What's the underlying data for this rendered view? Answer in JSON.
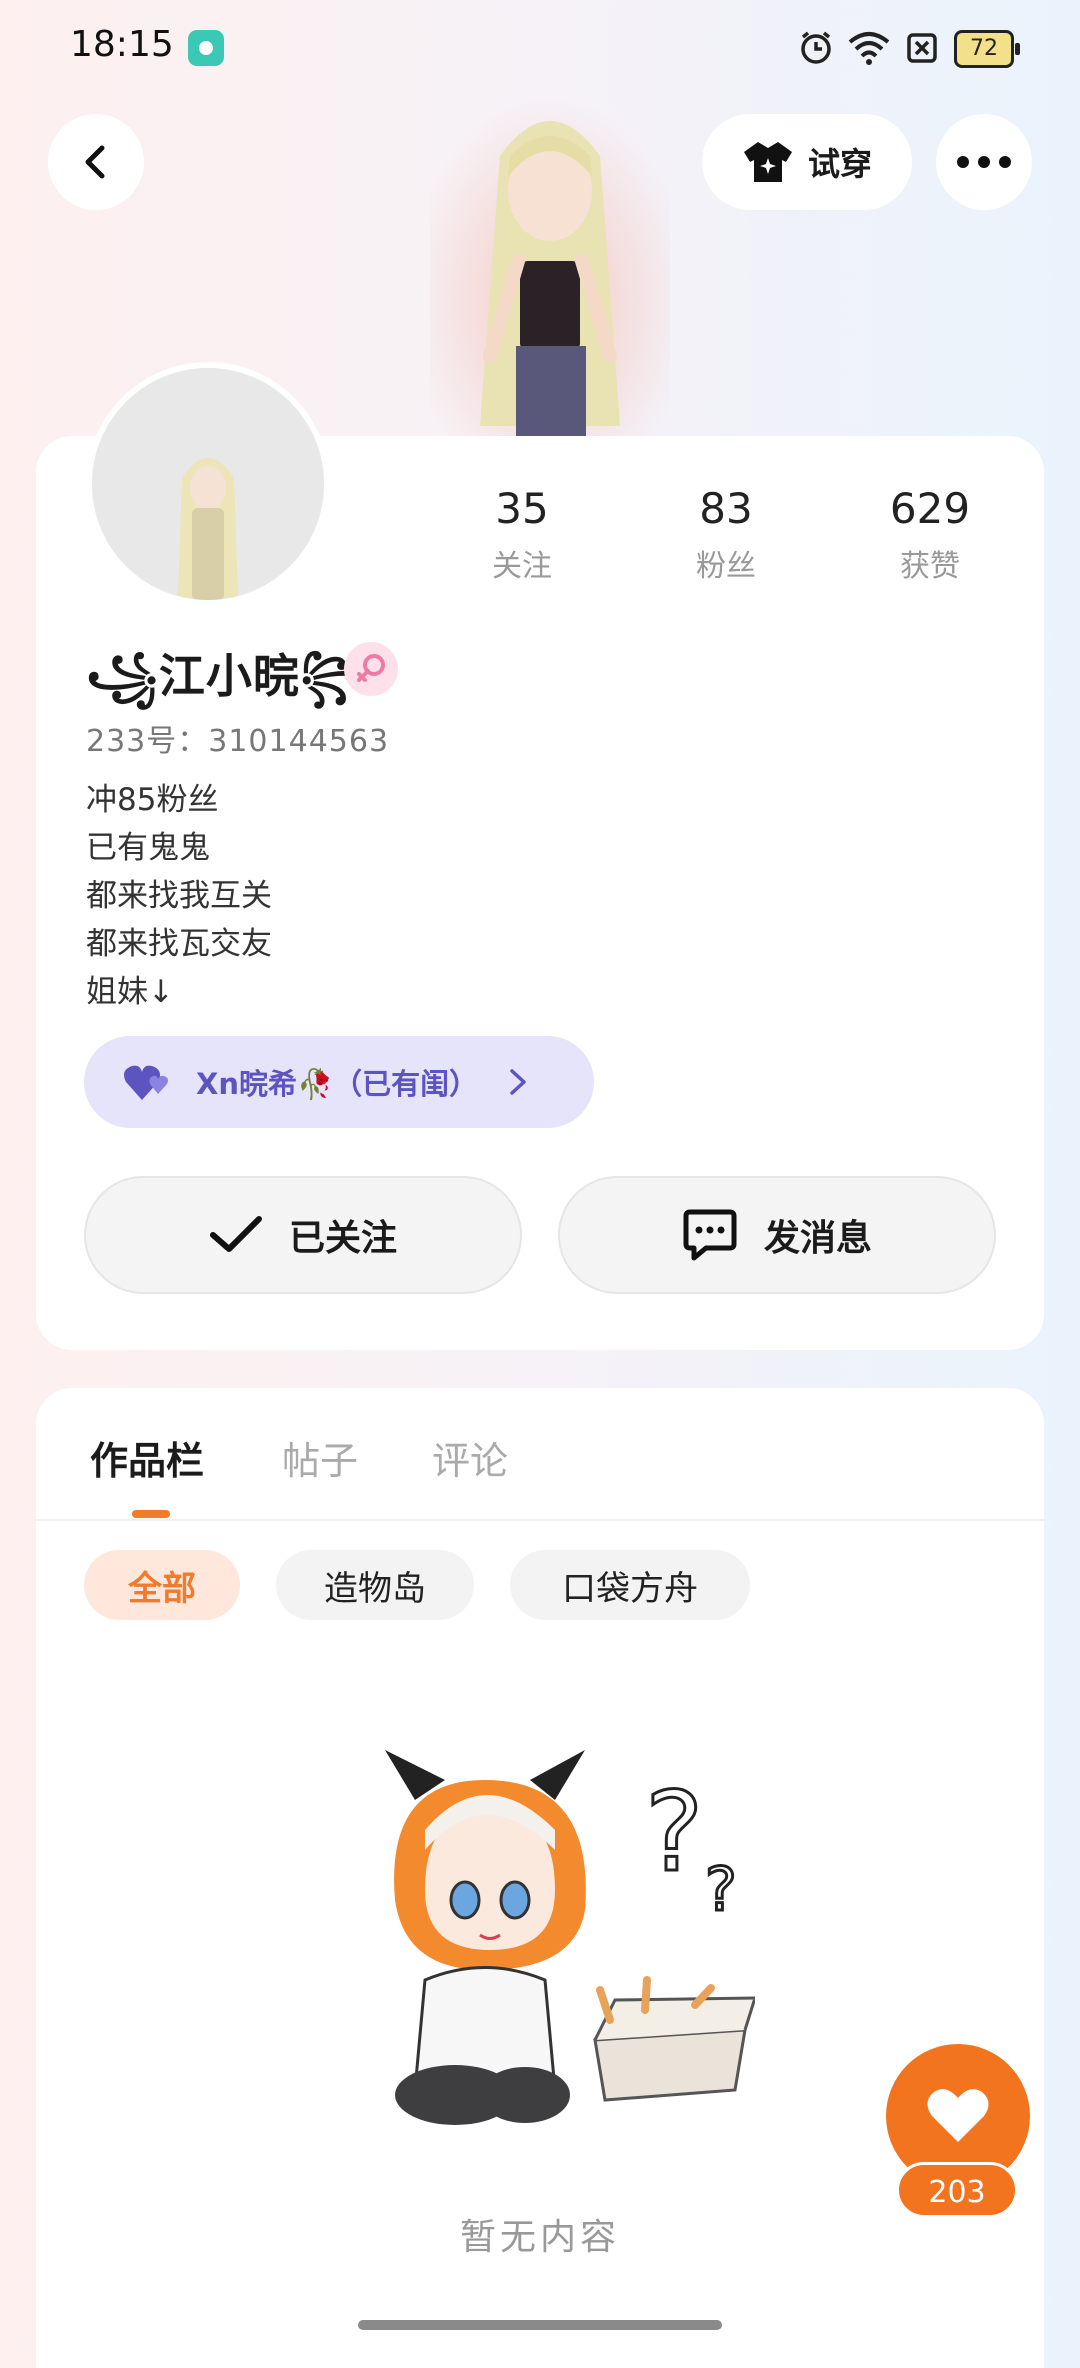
{
  "status_bar": {
    "time": "18:15",
    "battery": "72"
  },
  "top_bar": {
    "try_on_label": "试穿"
  },
  "profile": {
    "stats": [
      {
        "value": "35",
        "label": "关注"
      },
      {
        "value": "83",
        "label": "粉丝"
      },
      {
        "value": "629",
        "label": "获赞"
      }
    ],
    "nickname": "꧁江小晥꧂",
    "uid": "233号：310144563",
    "bio": [
      "冲85粉丝",
      "已有鬼鬼",
      "都来找我互关",
      "都来找瓦交友",
      "姐妹↓"
    ],
    "club_label": "Xn晥希🥀（已有闺）",
    "follow_label": "已关注",
    "message_label": "发消息"
  },
  "works": {
    "tabs": [
      "作品栏",
      "帖子",
      "评论"
    ],
    "filters": [
      "全部",
      "造物岛",
      "口袋方舟"
    ],
    "empty_text": "暂无内容"
  },
  "like_fab": {
    "count": "203"
  },
  "colors": {
    "accent": "#f2741f",
    "club": "#5c55c0",
    "gender": "#f07aa6"
  }
}
